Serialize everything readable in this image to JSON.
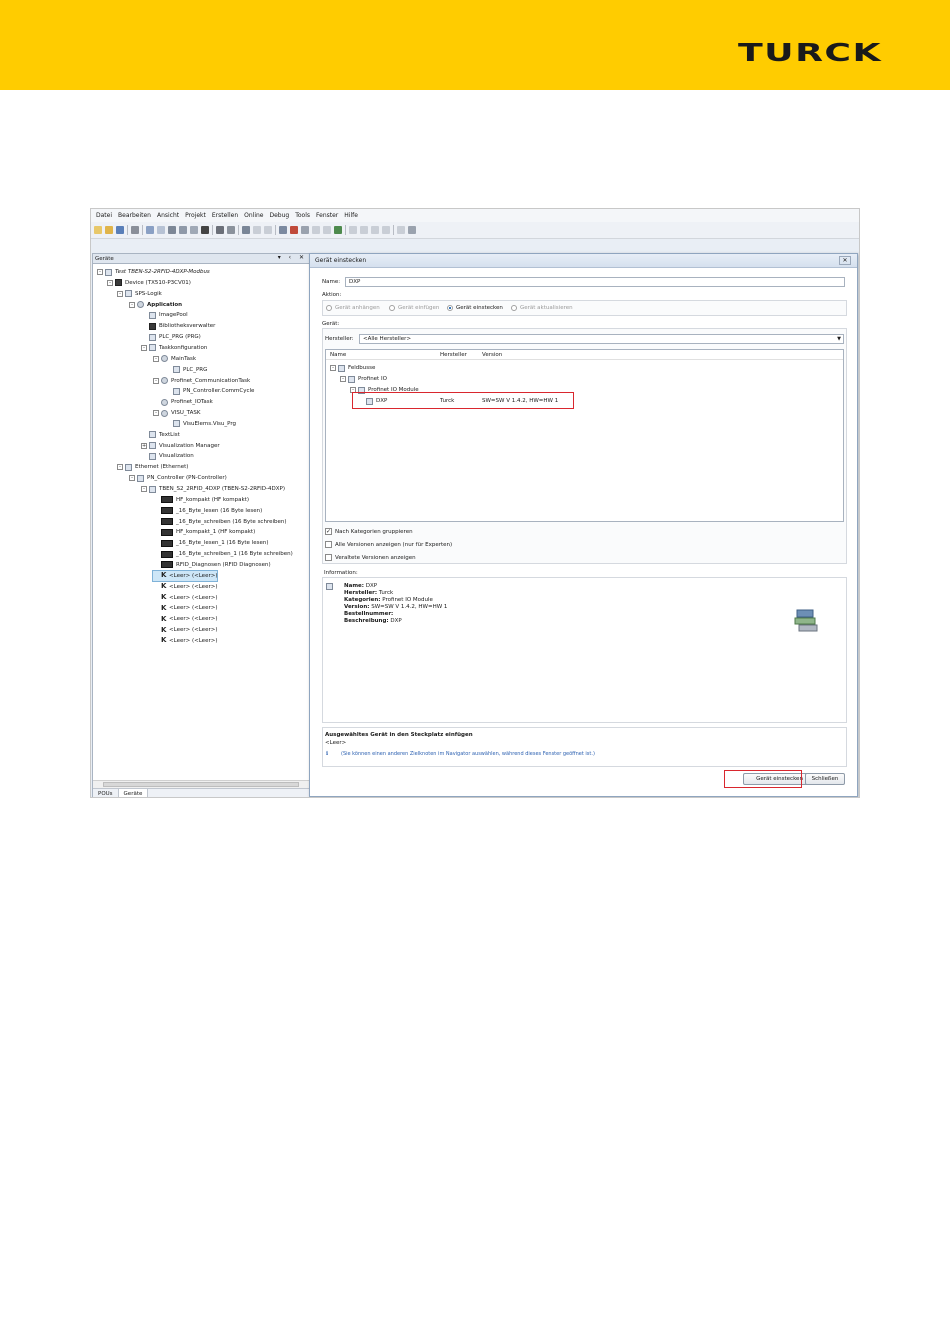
{
  "brand": {
    "logo_text": "TURCK",
    "header_color": "#ffcc00"
  },
  "menu": [
    "Datei",
    "Bearbeiten",
    "Ansicht",
    "Projekt",
    "Erstellen",
    "Online",
    "Debug",
    "Tools",
    "Fenster",
    "Hilfe"
  ],
  "devices_panel": {
    "title": "Geräte",
    "tree": [
      {
        "label": "Test TBEN-S2-2RFID-4DXP-Modbus",
        "icon": "project-icon",
        "exp": "-"
      },
      {
        "label": "Device (TX510-P3CV01)",
        "icon": "device-icon",
        "exp": "-"
      },
      {
        "label": "SPS-Logik",
        "icon": "plc-logic-icon",
        "exp": "-"
      },
      {
        "label": "Application",
        "icon": "application-icon",
        "exp": "-"
      },
      {
        "label": "ImagePool",
        "icon": "image-pool-icon",
        "exp": ""
      },
      {
        "label": "Bibliotheksverwalter",
        "icon": "library-icon",
        "exp": ""
      },
      {
        "label": "PLC_PRG (PRG)",
        "icon": "program-icon",
        "exp": ""
      },
      {
        "label": "Taskkonfiguration",
        "icon": "task-config-icon",
        "exp": "-"
      },
      {
        "label": "MainTask",
        "icon": "task-icon",
        "exp": "-"
      },
      {
        "label": "PLC_PRG",
        "icon": "program-icon",
        "exp": ""
      },
      {
        "label": "Profinet_CommunicationTask",
        "icon": "task-icon",
        "exp": "-"
      },
      {
        "label": "PN_Controller.CommCycle",
        "icon": "program-icon",
        "exp": ""
      },
      {
        "label": "Profinet_IOTask",
        "icon": "task-icon",
        "exp": ""
      },
      {
        "label": "VISU_TASK",
        "icon": "task-icon",
        "exp": "-"
      },
      {
        "label": "VisuElems.Visu_Prg",
        "icon": "program-icon",
        "exp": ""
      },
      {
        "label": "TextList",
        "icon": "textlist-icon",
        "exp": ""
      },
      {
        "label": "Visualization Manager",
        "icon": "visu-manager-icon",
        "exp": "+"
      },
      {
        "label": "Visualization",
        "icon": "visualization-icon",
        "exp": ""
      },
      {
        "label": "Ethernet (Ethernet)",
        "icon": "ethernet-icon",
        "exp": "-"
      },
      {
        "label": "PN_Controller (PN-Controller)",
        "icon": "pn-controller-icon",
        "exp": "-"
      },
      {
        "label": "TBEN_S2_2RFID_4DXP (TBEN-S2-2RFID-4DXP)",
        "icon": "io-device-icon",
        "exp": "-"
      },
      {
        "label": "HF_kompakt (HF kompakt)",
        "icon": "module-icon",
        "exp": ""
      },
      {
        "label": "_16_Byte_lesen (16 Byte lesen)",
        "icon": "module-icon",
        "exp": ""
      },
      {
        "label": "_16_Byte_schreiben (16 Byte schreiben)",
        "icon": "module-icon",
        "exp": ""
      },
      {
        "label": "HF_kompakt_1 (HF kompakt)",
        "icon": "module-icon",
        "exp": ""
      },
      {
        "label": "_16_Byte_lesen_1 (16 Byte lesen)",
        "icon": "module-icon",
        "exp": ""
      },
      {
        "label": "_16_Byte_schreiben_1 (16 Byte schreiben)",
        "icon": "module-icon",
        "exp": ""
      },
      {
        "label": "RFID_Diagnosen (RFID Diagnosen)",
        "icon": "module-icon",
        "exp": ""
      },
      {
        "label": "<Leer> (<Leer>)",
        "icon": "empty-slot-icon",
        "exp": "",
        "selected": true
      },
      {
        "label": "<Leer> (<Leer>)",
        "icon": "empty-slot-icon",
        "exp": ""
      },
      {
        "label": "<Leer> (<Leer>)",
        "icon": "empty-slot-icon",
        "exp": ""
      },
      {
        "label": "<Leer> (<Leer>)",
        "icon": "empty-slot-icon",
        "exp": ""
      },
      {
        "label": "<Leer> (<Leer>)",
        "icon": "empty-slot-icon",
        "exp": ""
      },
      {
        "label": "<Leer> (<Leer>)",
        "icon": "empty-slot-icon",
        "exp": ""
      },
      {
        "label": "<Leer> (<Leer>)",
        "icon": "empty-slot-icon",
        "exp": ""
      }
    ],
    "tabs": [
      "POUs",
      "Geräte"
    ]
  },
  "dialog": {
    "title": "Gerät einstecken",
    "name_label": "Name:",
    "name_value": "DXP",
    "action_label": "Aktion:",
    "actions": [
      "Gerät anhängen",
      "Gerät einfügen",
      "Gerät einstecken",
      "Gerät aktualisieren"
    ],
    "selected_action": 2,
    "device_label": "Gerät:",
    "vendor_label": "Hersteller:",
    "vendor_value": "<Alle Hersteller>",
    "columns": [
      "Name",
      "Hersteller",
      "Version"
    ],
    "list": {
      "feldbusse": "Feldbusse",
      "profinet_io": "Profinet IO",
      "profinet_io_module": "Profinet IO Module",
      "item_name": "DXP",
      "item_vendor": "Turck",
      "item_version": "SW=SW V 1.4.2, HW=HW 1"
    },
    "checkboxes": [
      {
        "label": "Nach Kategorien gruppieren",
        "checked": true
      },
      {
        "label": "Alle Versionen anzeigen (nur für Experten)",
        "checked": false
      },
      {
        "label": "Veraltete Versionen anzeigen",
        "checked": false
      }
    ],
    "info_label": "Information:",
    "info": {
      "name_k": "Name:",
      "name_v": "DXP",
      "vendor_k": "Hersteller:",
      "vendor_v": "Turck",
      "category_k": "Kategorien:",
      "category_v": "Profinet IO Module",
      "version_k": "Version:",
      "version_v": "SW=SW V 1.4.2, HW=HW 1",
      "order_k": "Bestellnummer:",
      "order_v": "",
      "desc_k": "Beschreibung:",
      "desc_v": "DXP"
    },
    "status_title": "Ausgewähltes Gerät in den Steckplatz einfügen",
    "status_slot": "<Leer>",
    "status_hint": "(Sie können einen anderen Zielknoten im Navigator auswählen, während dieses Fenster geöffnet ist.)",
    "btn_insert": "Gerät einstecken",
    "btn_close": "Schließen"
  },
  "colors": {
    "highlight": "#d9272e",
    "selection": "#cde6f7"
  }
}
